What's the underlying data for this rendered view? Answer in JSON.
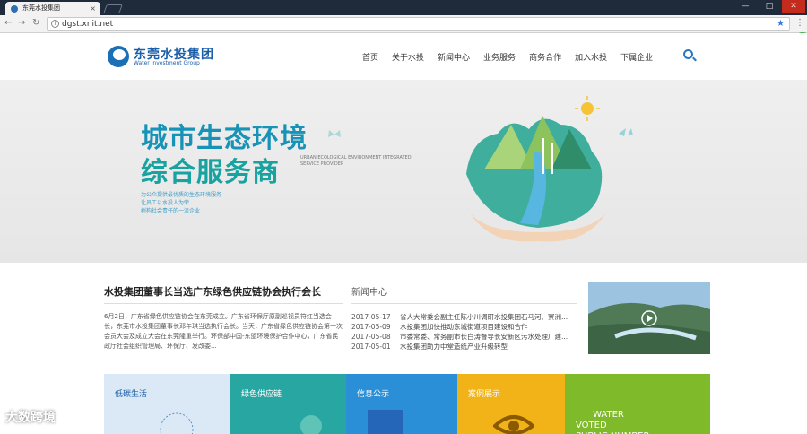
{
  "browser": {
    "tab_title": "东莞水投集团",
    "url": "dgst.xnit.net",
    "minimize_icon": "—",
    "maximize_icon": "□",
    "close_icon": "✕"
  },
  "site": {
    "logo_cn": "东莞水投集团",
    "logo_en": "Water Investment Group",
    "nav": [
      "首页",
      "关于水投",
      "新闻中心",
      "业务服务",
      "商务合作",
      "加入水投",
      "下属企业"
    ]
  },
  "banner": {
    "title_line1": "城市生态环境",
    "title_line2": "综合服务商",
    "english": "URBAN ECOLOGICAL ENVIRONMENT INTEGRATED SERVICE PROVIDER",
    "slogan": [
      "为公众提供最优质的生态环境服务",
      "让员工以水投人为荣",
      "树构社会责任的一流企业"
    ]
  },
  "news": {
    "title": "水投集团董事长当选广东绿色供应链协会执行会长",
    "body": "6月2日，广东省绿色供应链协会在东莞成立。广东省环保厅原副巡视员符红当选会长，东莞市水投集团董事长邓年琪当选执行会长。当天，广东省绿色供应链协会第一次会员大会及成立大会在东莞隆重举行。环保部中国-东盟环境保护合作中心，广东省民政厅社会组织管理局、环保厅、发改委..."
  },
  "side": {
    "heading": "新闻中心",
    "items": [
      {
        "date": "2017-05-17",
        "text": "省人大常委会副主任陈小川调研水投集团石马河、寮洲..."
      },
      {
        "date": "2017-05-09",
        "text": "水投集团加快推动东城街道项目建设和合作"
      },
      {
        "date": "2017-05-08",
        "text": "市委常委、常务副市长白涛督导长安新区污水处理厂建..."
      },
      {
        "date": "2017-05-01",
        "text": "水投集团助力中堂造纸产业升级转型"
      }
    ]
  },
  "tiles": [
    {
      "label": "低碳生活",
      "color": "#dbe9f7",
      "text_color": "#1e63a8"
    },
    {
      "label": "绿色供应链",
      "color": "#27a6a2",
      "text_color": "#ffffff"
    },
    {
      "label": "信息公示",
      "color": "#2a8fd6",
      "text_color": "#ffffff"
    },
    {
      "label": "案例展示",
      "color": "#f2b319",
      "text_color": "#ffffff"
    },
    {
      "label": "WATER\nVOTED\nPUBLIC NUMBER",
      "color": "#7fba2b",
      "text_color": "#ffffff"
    }
  ],
  "ext_label": "+",
  "watermark": "大数跨境"
}
